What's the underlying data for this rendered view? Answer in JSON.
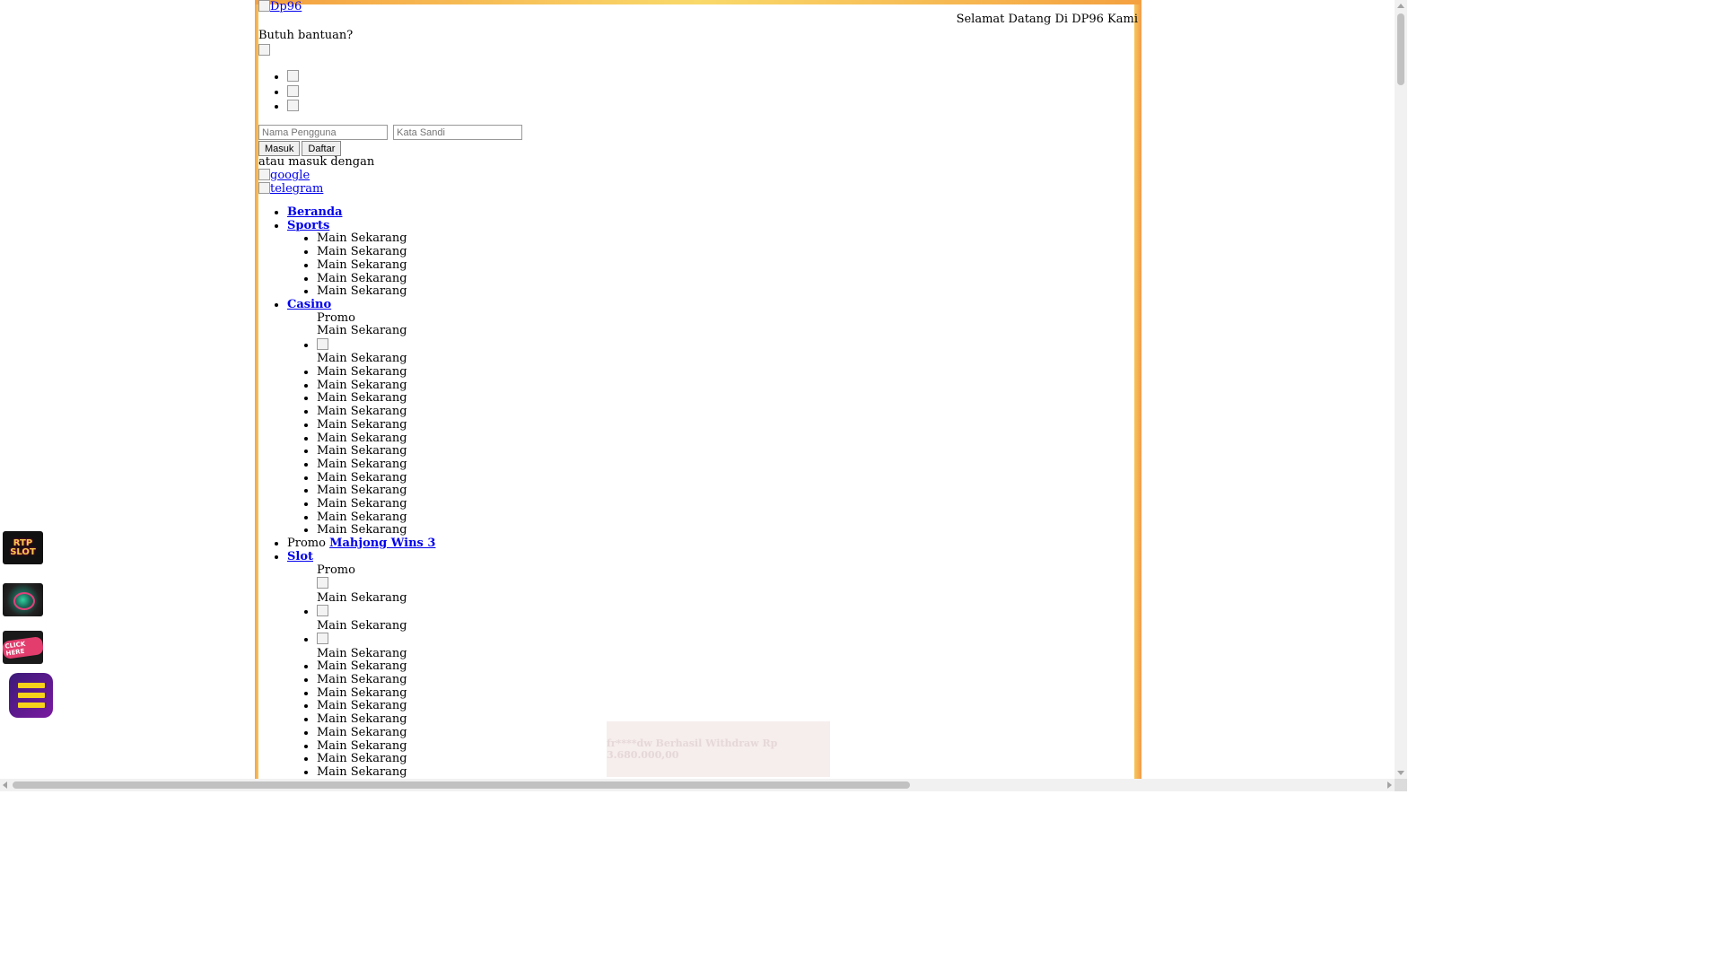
{
  "header": {
    "logo_alt": "Dp96",
    "welcome": "Selamat Datang Di DP96 Kami",
    "help": "Butuh bantuan?"
  },
  "login": {
    "username_placeholder": "Nama Pengguna",
    "password_placeholder": "Kata Sandi",
    "login_label": "Masuk",
    "register_label": "Daftar",
    "alt_text": "atau masuk dengan",
    "google_label": "google",
    "telegram_label": "telegram"
  },
  "menu": {
    "beranda": "Beranda",
    "sports": "Sports",
    "casino": "Casino",
    "slot": "Slot",
    "play": "Main Sekarang",
    "promo": "Promo",
    "mahjong": "Mahjong Wins 3"
  },
  "float_icons": {
    "rtp_line1": "RTP",
    "rtp_line2": "SLOT",
    "click_here": "CLICK HERE"
  },
  "toast": {
    "message": "fr****dw Berhasil Withdraw Rp 3.680.000,00"
  }
}
